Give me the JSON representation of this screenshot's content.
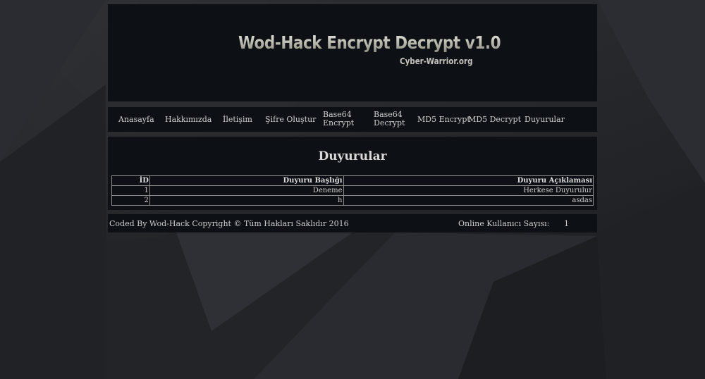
{
  "header": {
    "title": "Wod-Hack Encrypt Decrypt v1.0",
    "subtitle": "Cyber-Warrior.org"
  },
  "nav": {
    "items": [
      {
        "label": "Anasayfa"
      },
      {
        "label": "Hakkımızda"
      },
      {
        "label": "İletişim"
      },
      {
        "label": "Şifre Oluştur"
      },
      {
        "label_line1": "Base64",
        "label_line2": "Encrypt"
      },
      {
        "label_line1": "Base64",
        "label_line2": "Decrypt"
      },
      {
        "label": "MD5 Encrypt"
      },
      {
        "label": "MD5 Decrypt"
      },
      {
        "label": "Duyurular"
      }
    ]
  },
  "main": {
    "title": "Duyurular",
    "table": {
      "headers": [
        "İD",
        "Duyuru Başlığı",
        "Duyuru Açıklaması"
      ],
      "rows": [
        [
          "1",
          "Deneme",
          "Herkese Duyurulur"
        ],
        [
          "2",
          "h",
          "asdas"
        ]
      ]
    }
  },
  "footer": {
    "copyright": "Coded By Wod-Hack Copyright © Tüm Hakları Saklıdır 2016",
    "online_label": "Online Kullanıcı Sayısı:",
    "online_count": "1"
  },
  "colors": {
    "page_background": "#25272b",
    "panel_background": "#0d1015",
    "text": "#cfcfcf",
    "table_border": "#8c8c8c"
  }
}
